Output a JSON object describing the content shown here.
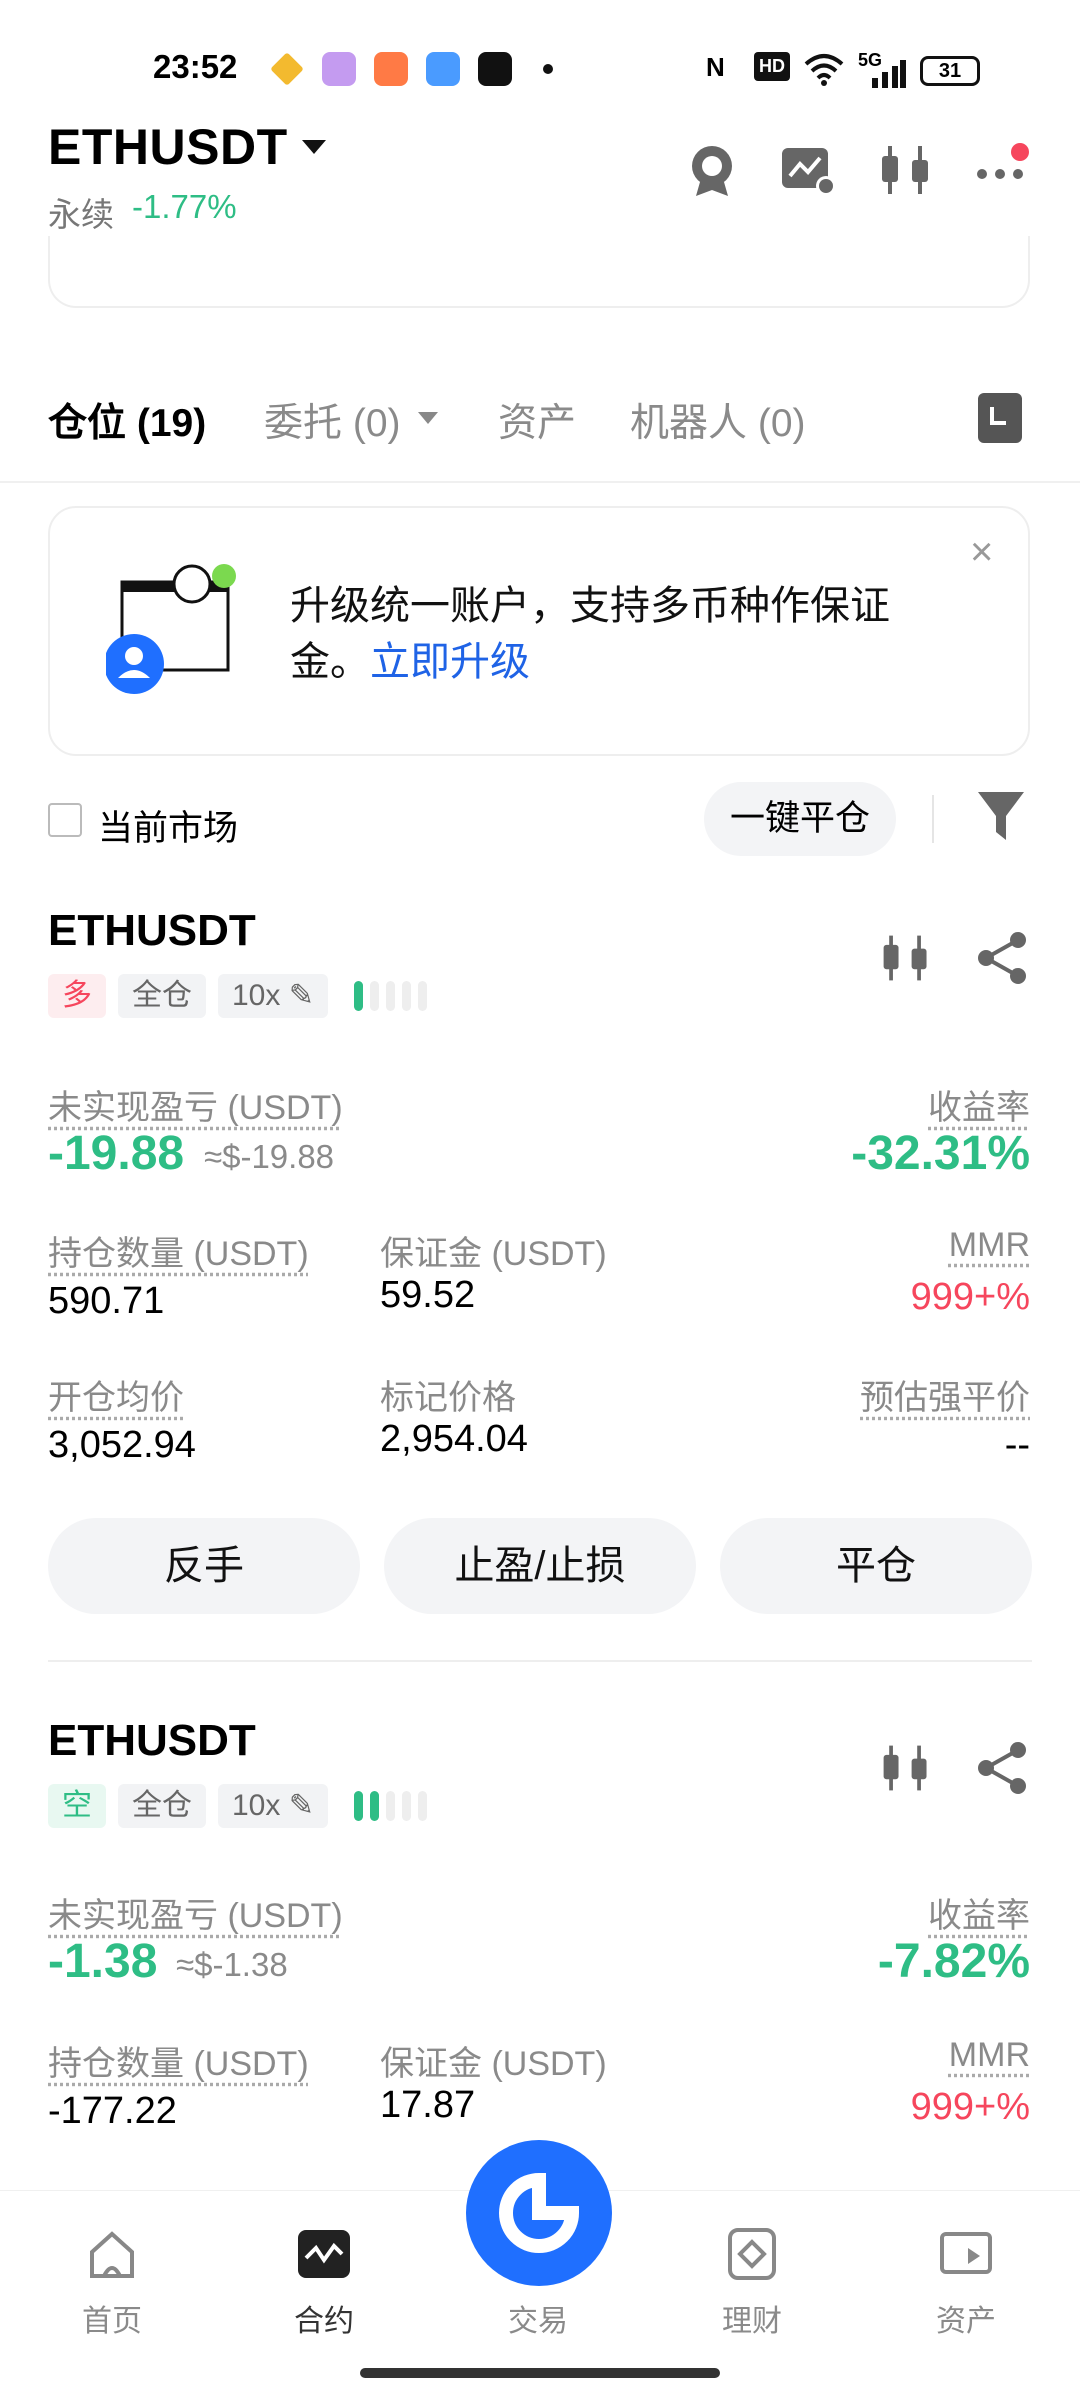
{
  "status_bar": {
    "time": "23:52",
    "network": "5G",
    "hd": "HD",
    "battery": "31"
  },
  "header": {
    "symbol": "ETHUSDT",
    "type_label": "永续",
    "change": "-1.77%"
  },
  "tabs": [
    {
      "label": "仓位 (19)",
      "active": true
    },
    {
      "label": "委托 (0)",
      "active": false
    },
    {
      "label": "资产",
      "active": false
    },
    {
      "label": "机器人 (0)",
      "active": false
    }
  ],
  "banner": {
    "text": "升级统一账户，支持多币种作保证金。",
    "link": "立即升级",
    "close": "×"
  },
  "filter": {
    "checkbox_label": "当前市场",
    "close_all": "一键平仓"
  },
  "positions": [
    {
      "symbol": "ETHUSDT",
      "side": "多",
      "margin_mode": "全仓",
      "leverage": "10x",
      "bars_on": 1,
      "pnl_label": "未实现盈亏 (USDT)",
      "pnl": "-19.88",
      "pnl_usd": "≈$-19.88",
      "roe_label": "收益率",
      "roe": "-32.31%",
      "size_label": "持仓数量 (USDT)",
      "size": "590.71",
      "margin_label": "保证金 (USDT)",
      "margin": "59.52",
      "mmr_label": "MMR",
      "mmr": "999+%",
      "entry_label": "开仓均价",
      "entry": "3,052.94",
      "mark_label": "标记价格",
      "mark": "2,954.04",
      "liq_label": "预估强平价",
      "liq": "--"
    },
    {
      "symbol": "ETHUSDT",
      "side": "空",
      "margin_mode": "全仓",
      "leverage": "10x",
      "bars_on": 2,
      "pnl_label": "未实现盈亏 (USDT)",
      "pnl": "-1.38",
      "pnl_usd": "≈$-1.38",
      "roe_label": "收益率",
      "roe": "-7.82%",
      "size_label": "持仓数量 (USDT)",
      "size": "-177.22",
      "margin_label": "保证金 (USDT)",
      "margin": "17.87",
      "mmr_label": "MMR",
      "mmr": "999+%"
    }
  ],
  "actions": {
    "reverse": "反手",
    "tpsl": "止盈/止损",
    "close": "平仓"
  },
  "nav": [
    {
      "label": "首页",
      "icon": "home-icon"
    },
    {
      "label": "合约",
      "icon": "futures-icon"
    },
    {
      "label": "交易",
      "icon": "trade-icon"
    },
    {
      "label": "理财",
      "icon": "earn-icon"
    },
    {
      "label": "资产",
      "icon": "wallet-icon"
    }
  ],
  "colors": {
    "green": "#2EBD85",
    "red": "#F6465D",
    "blue": "#1F63E6"
  }
}
